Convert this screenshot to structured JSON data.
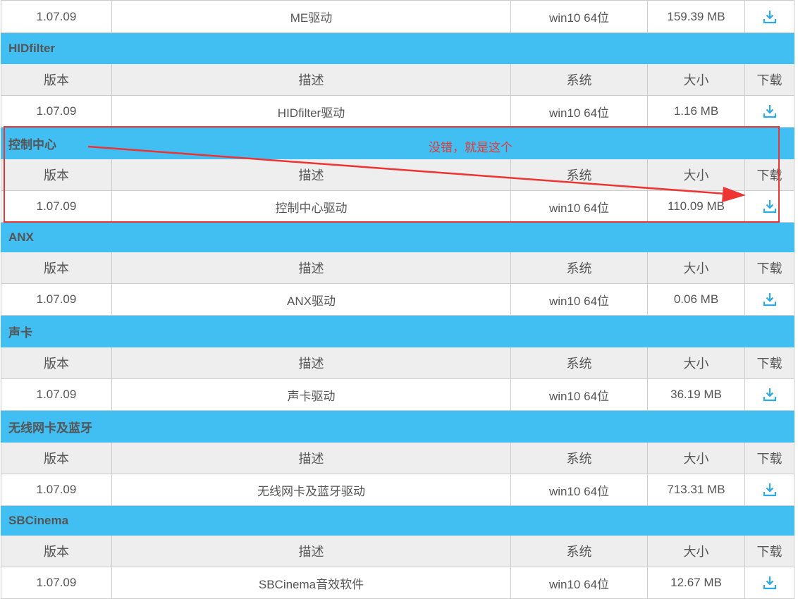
{
  "headers": {
    "version": "版本",
    "desc": "描述",
    "system": "系统",
    "size": "大小",
    "download": "下载"
  },
  "top_row": {
    "version": "1.07.09",
    "desc": "ME驱动",
    "system": "win10 64位",
    "size": "159.39 MB"
  },
  "sections": [
    {
      "title": "HIDfilter",
      "row": {
        "version": "1.07.09",
        "desc": "HIDfilter驱动",
        "system": "win10 64位",
        "size": "1.16 MB"
      }
    },
    {
      "title": "控制中心",
      "row": {
        "version": "1.07.09",
        "desc": "控制中心驱动",
        "system": "win10 64位",
        "size": "110.09 MB"
      }
    },
    {
      "title": "ANX",
      "row": {
        "version": "1.07.09",
        "desc": "ANX驱动",
        "system": "win10 64位",
        "size": "0.06 MB"
      }
    },
    {
      "title": "声卡",
      "row": {
        "version": "1.07.09",
        "desc": "声卡驱动",
        "system": "win10 64位",
        "size": "36.19 MB"
      }
    },
    {
      "title": "无线网卡及蓝牙",
      "row": {
        "version": "1.07.09",
        "desc": "无线网卡及蓝牙驱动",
        "system": "win10 64位",
        "size": "713.31 MB"
      }
    },
    {
      "title": "SBCinema",
      "row": {
        "version": "1.07.09",
        "desc": "SBCinema音效软件",
        "system": "win10 64位",
        "size": "12.67 MB"
      }
    }
  ],
  "annotation": {
    "text": "没错，就是这个"
  },
  "colors": {
    "section_bg": "#41bff3",
    "header_bg": "#eeeeee",
    "icon": "#2fa8e8",
    "annotation": "#ee3333"
  },
  "icons": {
    "download": "download-icon"
  }
}
